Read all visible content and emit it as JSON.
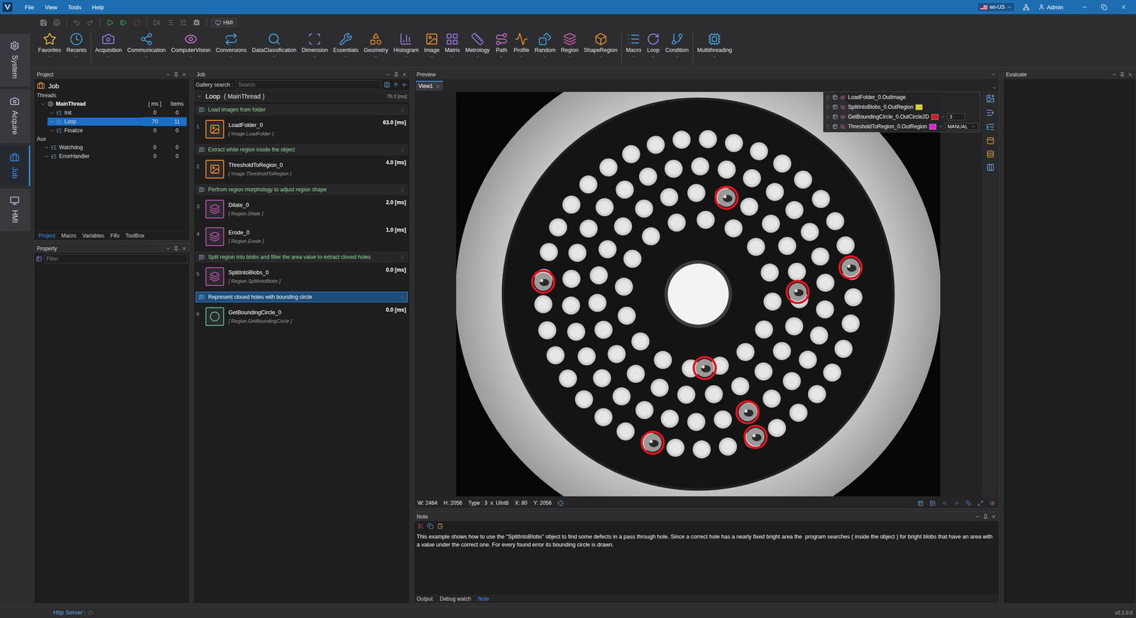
{
  "titlebar": {
    "menus": [
      "File",
      "View",
      "Tools",
      "Help"
    ],
    "language": "en-US",
    "user": "Admin"
  },
  "quickbar": {
    "hmi": "HMI"
  },
  "ribbon_groups": [
    [
      {
        "label": "Favorites",
        "color": "#f2c335"
      },
      {
        "label": "Recents",
        "color": "#4aa3e0"
      }
    ],
    [
      {
        "label": "Acquisition",
        "color": "#8c8ef0"
      },
      {
        "label": "Communication",
        "color": "#4a9fe0"
      },
      {
        "label": "ComputerVision",
        "color": "#d47ad8"
      },
      {
        "label": "Conversions",
        "color": "#4aa3e0"
      },
      {
        "label": "DataClassification",
        "color": "#4aa3e0"
      },
      {
        "label": "Dimension",
        "color": "#a47be0"
      },
      {
        "label": "Essentials",
        "color": "#4aa3e0"
      },
      {
        "label": "Geometry",
        "color": "#f0902a"
      },
      {
        "label": "Histogram",
        "color": "#a47be0"
      },
      {
        "label": "Image",
        "color": "#f0902a"
      },
      {
        "label": "Matrix",
        "color": "#a47be0"
      },
      {
        "label": "Metrology",
        "color": "#a47be0"
      },
      {
        "label": "Path",
        "color": "#d86ad0"
      },
      {
        "label": "Profile",
        "color": "#f0902a"
      },
      {
        "label": "Random",
        "color": "#4aa3e0"
      },
      {
        "label": "Region",
        "color": "#d05fa8"
      },
      {
        "label": "ShapeRegion",
        "color": "#f0902a"
      }
    ],
    [
      {
        "label": "Macro",
        "color": "#4aa3e0"
      },
      {
        "label": "Loop",
        "color": "#a47be0"
      },
      {
        "label": "Condition",
        "color": "#4aa3e0"
      }
    ],
    [
      {
        "label": "Multithreading",
        "color": "#4aa3e0"
      }
    ]
  ],
  "sidetabs": [
    {
      "label": "System",
      "selected": false
    },
    {
      "label": "Acquire",
      "selected": false
    },
    {
      "label": "Job",
      "selected": true
    },
    {
      "label": "HMI",
      "selected": false
    }
  ],
  "project": {
    "title": "Project",
    "job": "Job",
    "threads_label": "Threads",
    "tree": {
      "root": {
        "name": "MainThread",
        "expanded": true
      },
      "columns": [
        "[ ms ]",
        "Items"
      ],
      "rows": [
        {
          "name": "Init",
          "ms": "0",
          "items": "0",
          "selected": false,
          "expanded": true
        },
        {
          "name": "Loop",
          "ms": "70",
          "items": "11",
          "selected": true,
          "expanded": true
        },
        {
          "name": "Finalize",
          "ms": "0",
          "items": "0",
          "selected": false,
          "expanded": true
        }
      ],
      "aux_label": "Aux",
      "aux_rows": [
        {
          "name": "Watchdog",
          "ms": "0",
          "items": "0",
          "selected": false,
          "expanded": true
        },
        {
          "name": "ErrorHandler",
          "ms": "0",
          "items": "0",
          "selected": false,
          "expanded": true
        }
      ]
    },
    "tabs": [
      {
        "label": "Project",
        "selected": true
      },
      {
        "label": "Macro",
        "selected": false
      },
      {
        "label": "Variables",
        "selected": false
      },
      {
        "label": "Fifo",
        "selected": false
      },
      {
        "label": "ToolBox",
        "selected": false
      }
    ]
  },
  "property": {
    "title": "Property",
    "filter_placeholder": "Filter"
  },
  "job": {
    "title": "Job",
    "search_label": "Gallery search :",
    "search_placeholder": "Search",
    "loop_title": "Loop",
    "loop_thread": "( MainThread )",
    "loop_time": "70.0 [ms]",
    "items": [
      {
        "kind": "comment",
        "text": "Load images from folder",
        "selected": false
      },
      {
        "kind": "tool",
        "index": "1",
        "name": "LoadFolder_0",
        "type": "[ Image.LoadFolder ]",
        "time": "63.0 [ms]",
        "category": "image",
        "color": "#f0902a"
      },
      {
        "kind": "comment",
        "text": "Extract white region inside the object",
        "selected": false
      },
      {
        "kind": "tool",
        "index": "2",
        "name": "ThresholdToRegion_0",
        "type": "[ Image.ThresholdToRegion ]",
        "time": "4.0 [ms]",
        "category": "image",
        "color": "#f0902a"
      },
      {
        "kind": "comment",
        "text": "Perfrom region morphology to adjust region shape",
        "selected": false
      },
      {
        "kind": "tool",
        "index": "3",
        "name": "Dilate_0",
        "type": "[ Region.Dilate ]",
        "time": "2.0 [ms]",
        "category": "region",
        "color": "#c04fb0"
      },
      {
        "kind": "tool",
        "index": "4",
        "name": "Erode_0",
        "type": "[ Region.Erode ]",
        "time": "1.0 [ms]",
        "category": "region",
        "color": "#c04fb0"
      },
      {
        "kind": "comment",
        "text": "Split region into blobs and filter the area value to extract closed holes",
        "selected": false
      },
      {
        "kind": "tool",
        "index": "5",
        "name": "SplitIntoBlobs_0",
        "type": "[ Region.SplitIntoBlobs ]",
        "time": "0.0 [ms]",
        "category": "region",
        "color": "#c04fb0"
      },
      {
        "kind": "comment",
        "text": "Represent closed holes with bounding circle",
        "selected": true
      },
      {
        "kind": "tool",
        "index": "6",
        "name": "GetBoundingCircle_0",
        "type": "[ Region.GetBoundingCircle ]",
        "time": "0.0 [ms]",
        "category": "geometry",
        "color": "#5fb89a"
      }
    ]
  },
  "preview": {
    "title": "Preview",
    "view_tab": "View1",
    "legend": [
      {
        "label": "LoadFolder_0.OutImage",
        "kind": "image",
        "visible": true
      },
      {
        "label": "SplitIntoBlobs_0.OutRegion",
        "kind": "region",
        "visible": false,
        "color": "#d6d22a"
      },
      {
        "label": "GetBoundingCircle_0.OutCircle2D",
        "kind": "circle",
        "visible": true,
        "color": "#e0151f",
        "thickness": "3"
      },
      {
        "label": "ThresholdToRegion_0.OutRegion",
        "kind": "region",
        "visible": false,
        "color": "#e020e0",
        "mode": "MANUAL"
      }
    ],
    "status": [
      "W: 2464",
      "H: 2056",
      "Type : 3  x  UInt8",
      "X: 80",
      "Y: 2056"
    ]
  },
  "note": {
    "title": "Note",
    "text": "This example shows how to use the \"SplitIntoBlobs\" object to find some defects in a pass through hole. Since a correct hole has a nearly fixed bright area the  program searches ( inside the object ) for bright blobs that have an area with a value under the correct one. For every found error its bounding circle is drawn.",
    "tabs": [
      {
        "label": "Output",
        "selected": false
      },
      {
        "label": "Debug watch",
        "selected": false
      },
      {
        "label": "Note",
        "selected": true
      }
    ]
  },
  "evaluate": {
    "title": "Evaluate"
  },
  "statusbar": {
    "http": "Http Server :",
    "version": "v2.1.0.0"
  }
}
